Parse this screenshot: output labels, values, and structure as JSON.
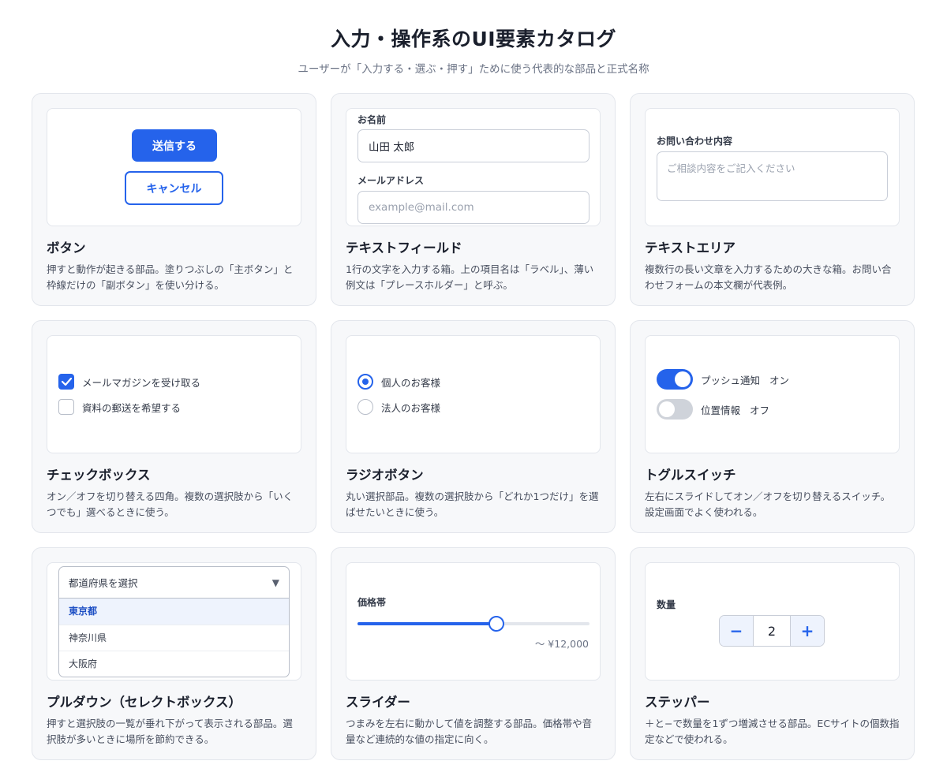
{
  "header": {
    "title": "入力・操作系のUI要素カタログ",
    "subtitle": "ユーザーが「入力する・選ぶ・押す」ために使う代表的な部品と正式名称"
  },
  "accent_color": "#2563eb",
  "cards": {
    "button": {
      "title": "ボタン",
      "desc": "押すと動作が起きる部品。塗りつぶしの「主ボタン」と枠線だけの「副ボタン」を使い分ける。",
      "primary_label": "送信する",
      "secondary_label": "キャンセル"
    },
    "textfield": {
      "title": "テキストフィールド",
      "desc": "1行の文字を入力する箱。上の項目名は「ラベル」、薄い例文は「プレースホルダー」と呼ぶ。",
      "name_label": "お名前",
      "name_value": "山田 太郎",
      "email_label": "メールアドレス",
      "email_placeholder": "example@mail.com"
    },
    "textarea": {
      "title": "テキストエリア",
      "desc": "複数行の長い文章を入力するための大きな箱。お問い合わせフォームの本文欄が代表例。",
      "label": "お問い合わせ内容",
      "placeholder": "ご相談内容をご記入ください"
    },
    "checkbox": {
      "title": "チェックボックス",
      "desc": "オン／オフを切り替える四角。複数の選択肢から「いくつでも」選べるときに使う。",
      "options": [
        {
          "label": "メールマガジンを受け取る",
          "checked": true
        },
        {
          "label": "資料の郵送を希望する",
          "checked": false
        }
      ]
    },
    "radio": {
      "title": "ラジオボタン",
      "desc": "丸い選択部品。複数の選択肢から「どれか1つだけ」を選ばせたいときに使う。",
      "options": [
        {
          "label": "個人のお客様",
          "checked": true
        },
        {
          "label": "法人のお客様",
          "checked": false
        }
      ]
    },
    "toggle": {
      "title": "トグルスイッチ",
      "desc": "左右にスライドしてオン／オフを切り替えるスイッチ。設定画面でよく使われる。",
      "items": [
        {
          "label": "プッシュ通知",
          "state": "オン",
          "on": true
        },
        {
          "label": "位置情報",
          "state": "オフ",
          "on": false
        }
      ]
    },
    "select": {
      "title": "プルダウン（セレクトボックス）",
      "desc": "押すと選択肢の一覧が垂れ下がって表示される部品。選択肢が多いときに場所を節約できる。",
      "placeholder": "都道府県を選択",
      "options": [
        "東京都",
        "神奈川県",
        "大阪府"
      ],
      "highlighted": "東京都"
    },
    "slider": {
      "title": "スライダー",
      "desc": "つまみを左右に動かして値を調整する部品。価格帯や音量など連続的な値の指定に向く。",
      "label": "価格帯",
      "value_text": "〜 ¥12,000",
      "fraction": 0.6
    },
    "stepper": {
      "title": "ステッパー",
      "desc": "＋と−で数量を1ずつ増減させる部品。ECサイトの個数指定などで使われる。",
      "label": "数量",
      "minus": "−",
      "plus": "+",
      "value": "2"
    }
  }
}
